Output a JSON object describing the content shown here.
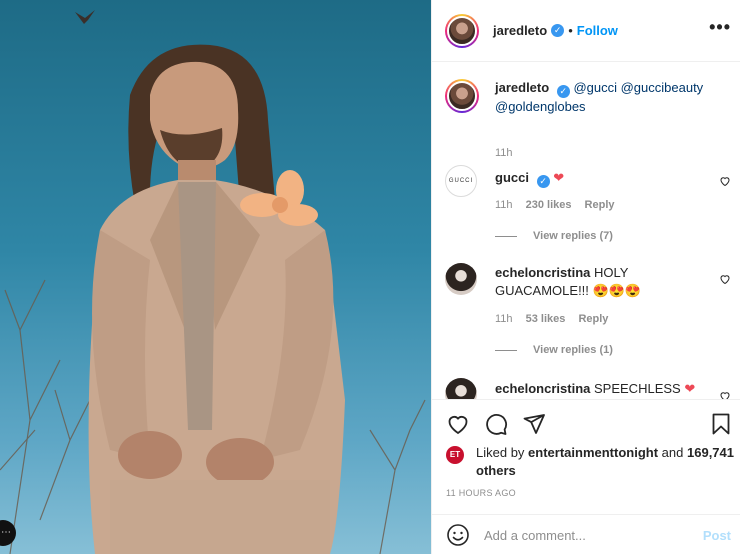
{
  "post": {
    "username": "jaredleto",
    "verified_icon": "verified-badge-icon",
    "separator": "•",
    "follow_label": "Follow",
    "more_label": "•••",
    "caption": {
      "username": "jaredleto",
      "mentions": [
        "@gucci",
        "@guccibeauty",
        "@goldenglobes"
      ],
      "time": "11h"
    }
  },
  "comments": [
    {
      "username": "gucci",
      "text": "",
      "emoji": "❤",
      "time": "11h",
      "likes": "230 likes",
      "reply_label": "Reply",
      "view_replies": "View replies (7)"
    },
    {
      "username": "echeloncristina",
      "text": "HOLY GUACAMOLE!!!",
      "emoji": "😍😍😍",
      "time": "11h",
      "likes": "53 likes",
      "reply_label": "Reply",
      "view_replies": "View replies (1)"
    },
    {
      "username": "echeloncristina",
      "text": "SPEECHLESS",
      "emoji": "❤"
    }
  ],
  "likes": {
    "prefix": "Liked by",
    "by_user": "entertainmenttonight",
    "conj": "and",
    "others": "169,741 others",
    "avatar_text": "ET"
  },
  "posted_ago": "11 HOURS AGO",
  "add_comment": {
    "placeholder": "Add a comment...",
    "post_label": "Post"
  },
  "gucci_avatar_text": "GUCCI",
  "colors": {
    "accent": "#0095f6",
    "verified": "#3897f0",
    "heart": "#ed4956",
    "muted": "#8e8e8e"
  }
}
